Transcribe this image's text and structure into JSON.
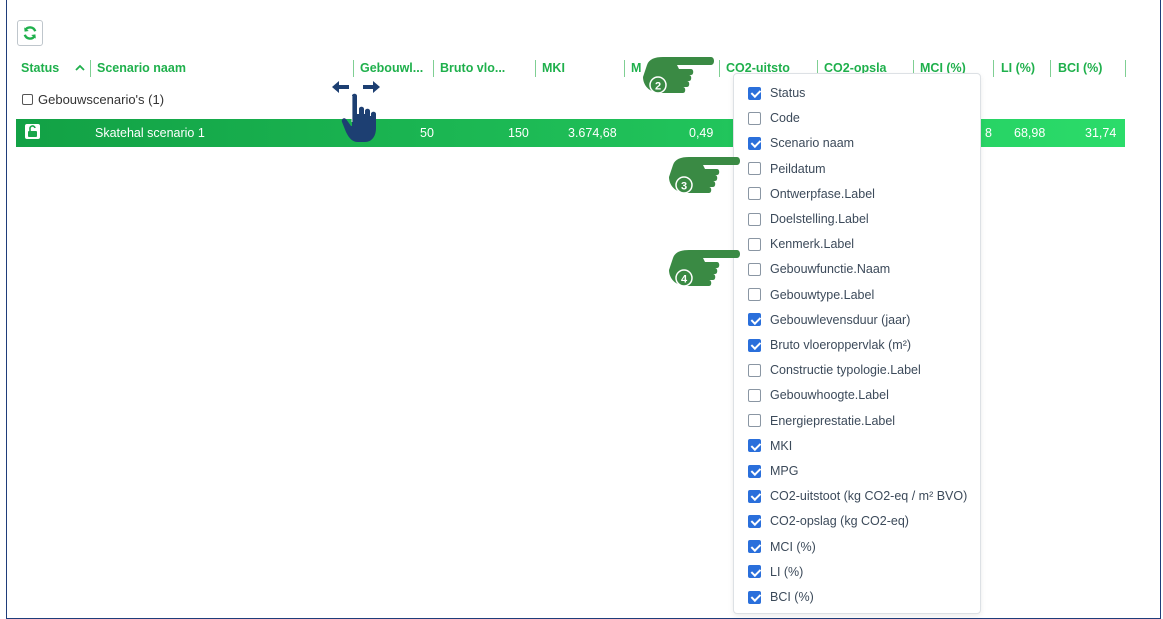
{
  "colors": {
    "accent": "#1fb04c",
    "row_start": "#12a145",
    "row_end": "#2bdc6a",
    "checkbox_on": "#2a6fdb",
    "callout": "#3a8a44",
    "hand": "#1d3f72"
  },
  "toolbar": {
    "refresh_icon": "refresh-icon"
  },
  "header": {
    "columns": [
      "Status",
      "Scenario naam",
      "Gebouwl...",
      "Bruto vlo...",
      "MKI",
      "M",
      "CO2-uitsto",
      "CO2-opsla",
      "MCI (%)",
      "LI (%)",
      "BCI (%)"
    ]
  },
  "group": {
    "label": "Gebouwscenario's (1)"
  },
  "row": {
    "lock_icon": "lock-open-icon",
    "name": "Skatehal scenario 1",
    "gebouwlevensduur": "50",
    "bruto_vloeroppervlak": "150",
    "mki": "3.674,68",
    "mpg": "0,49",
    "mci_partial": "8",
    "li": "68,98",
    "bci": "31,74"
  },
  "column_chooser": {
    "options": [
      {
        "label": "Status",
        "checked": true
      },
      {
        "label": "Code",
        "checked": false
      },
      {
        "label": "Scenario naam",
        "checked": true
      },
      {
        "label": "Peildatum",
        "checked": false
      },
      {
        "label": "Ontwerpfase.Label",
        "checked": false
      },
      {
        "label": "Doelstelling.Label",
        "checked": false
      },
      {
        "label": "Kenmerk.Label",
        "checked": false
      },
      {
        "label": "Gebouwfunctie.Naam",
        "checked": false
      },
      {
        "label": "Gebouwtype.Label",
        "checked": false
      },
      {
        "label": "Gebouwlevensduur (jaar)",
        "checked": true
      },
      {
        "label": "Bruto vloeroppervlak (m²)",
        "checked": true
      },
      {
        "label": "Constructie typologie.Label",
        "checked": false
      },
      {
        "label": "Gebouwhoogte.Label",
        "checked": false
      },
      {
        "label": "Energieprestatie.Label",
        "checked": false
      },
      {
        "label": "MKI",
        "checked": true
      },
      {
        "label": "MPG",
        "checked": true
      },
      {
        "label": "CO2-uitstoot (kg CO2-eq / m² BVO)",
        "checked": true
      },
      {
        "label": "CO2-opslag (kg CO2-eq)",
        "checked": true
      },
      {
        "label": "MCI (%)",
        "checked": true
      },
      {
        "label": "LI (%)",
        "checked": true
      },
      {
        "label": "BCI (%)",
        "checked": true
      }
    ]
  },
  "callouts": [
    {
      "number": "2",
      "icon": "pointing-hand-icon"
    },
    {
      "number": "3",
      "icon": "pointing-hand-icon"
    },
    {
      "number": "4",
      "icon": "pointing-hand-icon"
    }
  ],
  "resize_hint": {
    "icon": "resize-hand-icon"
  }
}
